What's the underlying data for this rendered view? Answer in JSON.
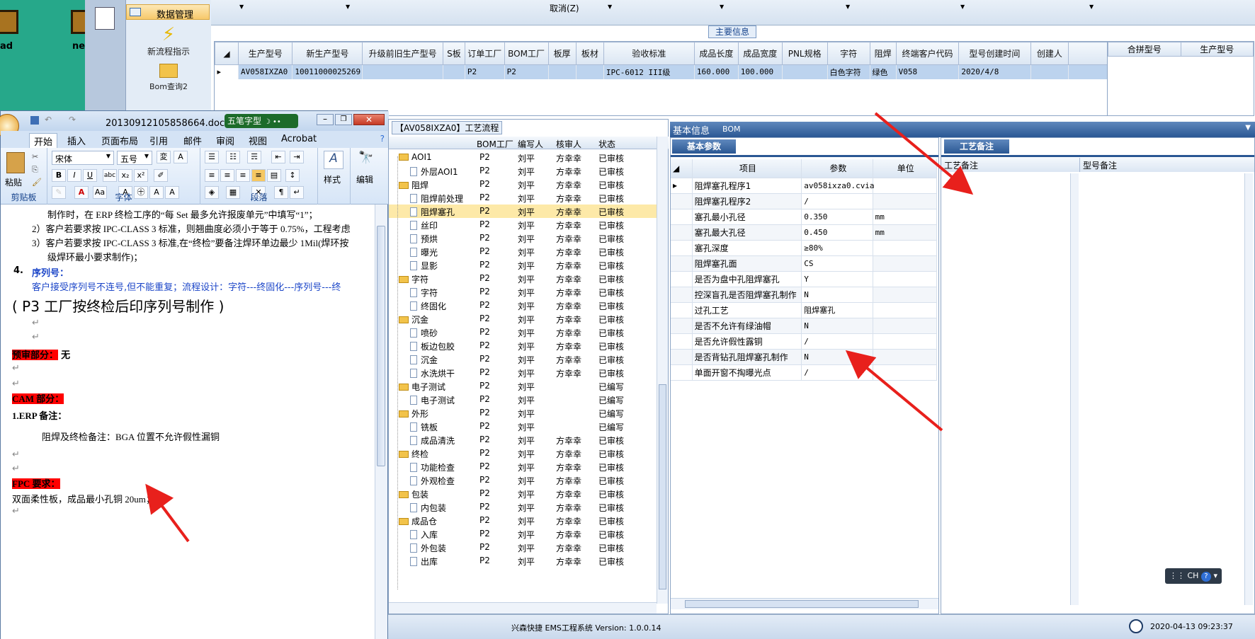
{
  "desktop": {
    "icon1_label": "ad",
    "icon2_label": "ne"
  },
  "nav": {
    "data_mgmt": "数据管理",
    "new_flow": "新流程指示",
    "bom_query": "Bom查询2"
  },
  "toolbar": {
    "cancel": "取消(Z)"
  },
  "main_info": {
    "title": "主要信息",
    "columns": [
      "生产型号",
      "新生产型号",
      "升级前旧生产型号",
      "S板",
      "订单工厂",
      "BOM工厂",
      "板厚",
      "板材",
      "验收标准",
      "成品长度",
      "成品宽度",
      "PNL规格",
      "字符",
      "阻焊",
      "终端客户代码",
      "型号创建时间",
      "创建人"
    ],
    "row": [
      "AV058IXZA0",
      "10011000025269",
      "",
      "",
      "P2",
      "P2",
      "",
      "",
      "IPC-6012 III级",
      "160.000",
      "100.000",
      "",
      "白色字符",
      "绿色",
      "V058",
      "2020/4/8",
      ""
    ],
    "merge_columns": [
      "合拼型号",
      "生产型号"
    ]
  },
  "word": {
    "filename": "20130912105858664.doc [兼容",
    "ime": "五笔字型",
    "tabs": [
      "开始",
      "插入",
      "页面布局",
      "引用",
      "邮件",
      "审阅",
      "视图",
      "Acrobat"
    ],
    "font_name": "宋体",
    "font_size": "五号",
    "groups": [
      "剪贴板",
      "字体",
      "段落",
      "样式",
      "编辑"
    ],
    "paste": "粘贴",
    "style_btn": "样式",
    "edit_btn": "编辑",
    "lines": {
      "l1": "制作时，在 ERP 终检工序的“每 Set 最多允许报废单元”中填写“1”；",
      "l2": "2）客户若要求按 IPC-CLASS 3 标准，则翘曲度必须小于等于 0.75%，工程考虑",
      "l3": "3）客户若要求按 IPC-CLASS 3 标准,在“终检”要备注焊环单边最少 1Mil(焊环按",
      "l4": "级焊环最小要求制作)；",
      "l5_num": "4.",
      "l5": "序列号：",
      "l6": "客户接受序列号不连号,但不能重复；流程设计：字符---终固化---序列号---终",
      "l7": "( P3 工厂按终检后印序列号制作 )",
      "pre_review": "预审部分：",
      "pre_review_val": "无",
      "cam": "CAM 部分：",
      "erp": "1.ERP 备注：",
      "solder_note": "阻焊及终检备注：BGA 位置不允许假性漏铜",
      "fpc": "FPC 要求：",
      "fpc_text": "双面柔性板，成品最小孔铜 20um；"
    }
  },
  "process": {
    "title": "【AV058IXZA0】工艺流程",
    "columns": [
      "BOM工厂",
      "编写人",
      "核审人",
      "状态"
    ],
    "rows": [
      {
        "name": "AOI1",
        "folder": true,
        "f": "P2",
        "w": "刘平",
        "r": "方幸幸",
        "s": "已审核"
      },
      {
        "name": "外层AOI1",
        "folder": false,
        "f": "P2",
        "w": "刘平",
        "r": "方幸幸",
        "s": "已审核"
      },
      {
        "name": "阻焊",
        "folder": true,
        "f": "P2",
        "w": "刘平",
        "r": "方幸幸",
        "s": "已审核"
      },
      {
        "name": "阻焊前处理",
        "folder": false,
        "f": "P2",
        "w": "刘平",
        "r": "方幸幸",
        "s": "已审核"
      },
      {
        "name": "阻焊塞孔",
        "folder": false,
        "f": "P2",
        "w": "刘平",
        "r": "方幸幸",
        "s": "已审核",
        "sel": true
      },
      {
        "name": "丝印",
        "folder": false,
        "f": "P2",
        "w": "刘平",
        "r": "方幸幸",
        "s": "已审核"
      },
      {
        "name": "预烘",
        "folder": false,
        "f": "P2",
        "w": "刘平",
        "r": "方幸幸",
        "s": "已审核"
      },
      {
        "name": "曝光",
        "folder": false,
        "f": "P2",
        "w": "刘平",
        "r": "方幸幸",
        "s": "已审核"
      },
      {
        "name": "显影",
        "folder": false,
        "f": "P2",
        "w": "刘平",
        "r": "方幸幸",
        "s": "已审核"
      },
      {
        "name": "字符",
        "folder": true,
        "f": "P2",
        "w": "刘平",
        "r": "方幸幸",
        "s": "已审核"
      },
      {
        "name": "字符",
        "folder": false,
        "f": "P2",
        "w": "刘平",
        "r": "方幸幸",
        "s": "已审核"
      },
      {
        "name": "终固化",
        "folder": false,
        "f": "P2",
        "w": "刘平",
        "r": "方幸幸",
        "s": "已审核"
      },
      {
        "name": "沉金",
        "folder": true,
        "f": "P2",
        "w": "刘平",
        "r": "方幸幸",
        "s": "已审核"
      },
      {
        "name": "喷砂",
        "folder": false,
        "f": "P2",
        "w": "刘平",
        "r": "方幸幸",
        "s": "已审核"
      },
      {
        "name": "板边包胶",
        "folder": false,
        "f": "P2",
        "w": "刘平",
        "r": "方幸幸",
        "s": "已审核"
      },
      {
        "name": "沉金",
        "folder": false,
        "f": "P2",
        "w": "刘平",
        "r": "方幸幸",
        "s": "已审核"
      },
      {
        "name": "水洗烘干",
        "folder": false,
        "f": "P2",
        "w": "刘平",
        "r": "方幸幸",
        "s": "已审核"
      },
      {
        "name": "电子测试",
        "folder": true,
        "f": "P2",
        "w": "刘平",
        "r": "",
        "s": "已编写"
      },
      {
        "name": "电子测试",
        "folder": false,
        "f": "P2",
        "w": "刘平",
        "r": "",
        "s": "已编写"
      },
      {
        "name": "外形",
        "folder": true,
        "f": "P2",
        "w": "刘平",
        "r": "",
        "s": "已编写"
      },
      {
        "name": "铣板",
        "folder": false,
        "f": "P2",
        "w": "刘平",
        "r": "",
        "s": "已编写"
      },
      {
        "name": "成品清洗",
        "folder": false,
        "f": "P2",
        "w": "刘平",
        "r": "方幸幸",
        "s": "已审核"
      },
      {
        "name": "终检",
        "folder": true,
        "f": "P2",
        "w": "刘平",
        "r": "方幸幸",
        "s": "已审核"
      },
      {
        "name": "功能检查",
        "folder": false,
        "f": "P2",
        "w": "刘平",
        "r": "方幸幸",
        "s": "已审核"
      },
      {
        "name": "外观检查",
        "folder": false,
        "f": "P2",
        "w": "刘平",
        "r": "方幸幸",
        "s": "已审核"
      },
      {
        "name": "包装",
        "folder": true,
        "f": "P2",
        "w": "刘平",
        "r": "方幸幸",
        "s": "已审核"
      },
      {
        "name": "内包装",
        "folder": false,
        "f": "P2",
        "w": "刘平",
        "r": "方幸幸",
        "s": "已审核"
      },
      {
        "name": "成品仓",
        "folder": true,
        "f": "P2",
        "w": "刘平",
        "r": "方幸幸",
        "s": "已审核"
      },
      {
        "name": "入库",
        "folder": false,
        "f": "P2",
        "w": "刘平",
        "r": "方幸幸",
        "s": "已审核"
      },
      {
        "name": "外包装",
        "folder": false,
        "f": "P2",
        "w": "刘平",
        "r": "方幸幸",
        "s": "已审核"
      },
      {
        "name": "出库",
        "folder": false,
        "f": "P2",
        "w": "刘平",
        "r": "方幸幸",
        "s": "已审核"
      }
    ]
  },
  "basic": {
    "tab1": "基本信息",
    "tab2": "BOM",
    "subtab": "基本参数",
    "columns": [
      "项目",
      "参数",
      "单位"
    ],
    "rows": [
      {
        "item": "阻焊塞孔程序1",
        "val": "av058ixza0.cvia",
        "unit": ""
      },
      {
        "item": "阻焊塞孔程序2",
        "val": "/",
        "unit": ""
      },
      {
        "item": "塞孔最小孔径",
        "val": "0.350",
        "unit": "mm"
      },
      {
        "item": "塞孔最大孔径",
        "val": "0.450",
        "unit": "mm"
      },
      {
        "item": "塞孔深度",
        "val": "≥80%",
        "unit": ""
      },
      {
        "item": "阻焊塞孔面",
        "val": "CS",
        "unit": ""
      },
      {
        "item": "是否为盘中孔阻焊塞孔",
        "val": "Y",
        "unit": ""
      },
      {
        "item": "控深盲孔是否阻焊塞孔制作",
        "val": "N",
        "unit": ""
      },
      {
        "item": "过孔工艺",
        "val": "阻焊塞孔",
        "unit": ""
      },
      {
        "item": "是否不允许有绿油帽",
        "val": "N",
        "unit": ""
      },
      {
        "item": "是否允许假性露铜",
        "val": "/",
        "unit": ""
      },
      {
        "item": "是否背钻孔阻焊塞孔制作",
        "val": "N",
        "unit": ""
      },
      {
        "item": "单面开窗不掏曝光点",
        "val": "/",
        "unit": ""
      }
    ]
  },
  "remark": {
    "tab": "工艺备注",
    "col1": "工艺备注",
    "col2": "型号备注"
  },
  "status": {
    "system": "兴森快捷 EMS工程系统 Version: 1.0.0.14",
    "datetime": "2020-04-13 09:23:37"
  },
  "langbar": {
    "text": "CH"
  }
}
